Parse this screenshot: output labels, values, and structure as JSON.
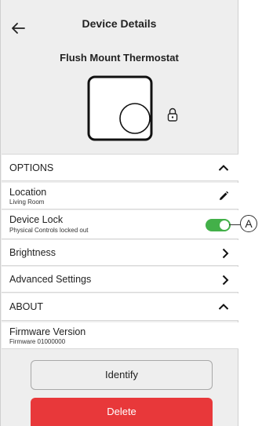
{
  "header": {
    "title": "Device Details",
    "device_name": "Flush Mount Thermostat"
  },
  "options_section": {
    "label": "OPTIONS",
    "expanded": true
  },
  "location": {
    "label": "Location",
    "value": "Living Room"
  },
  "device_lock": {
    "label": "Device Lock",
    "status": "Physical Controls locked out",
    "enabled": true
  },
  "brightness": {
    "label": "Brightness"
  },
  "advanced_settings": {
    "label": "Advanced Settings"
  },
  "about_section": {
    "label": "ABOUT",
    "expanded": true
  },
  "firmware": {
    "label": "Firmware Version",
    "value": "Firmware 01000000"
  },
  "buttons": {
    "identify": "Identify",
    "delete": "Delete"
  },
  "callout": {
    "label": "A"
  },
  "colors": {
    "toggle_on": "#43b049",
    "delete": "#e8383a",
    "background": "#eeeeee"
  }
}
